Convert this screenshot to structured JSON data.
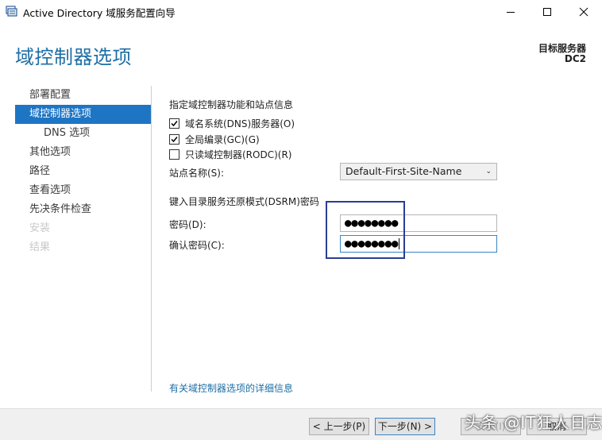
{
  "window": {
    "title": "Active Directory 域服务配置向导",
    "icon": "server-manager-icon"
  },
  "header": {
    "page_title": "域控制器选项",
    "target_label": "目标服务器",
    "target_value": "DC2"
  },
  "nav": {
    "items": [
      {
        "label": "部署配置",
        "state": "normal"
      },
      {
        "label": "域控制器选项",
        "state": "active"
      },
      {
        "label": "DNS 选项",
        "state": "sub"
      },
      {
        "label": "其他选项",
        "state": "normal"
      },
      {
        "label": "路径",
        "state": "normal"
      },
      {
        "label": "查看选项",
        "state": "normal"
      },
      {
        "label": "先决条件检查",
        "state": "normal"
      },
      {
        "label": "安装",
        "state": "disabled"
      },
      {
        "label": "结果",
        "state": "disabled"
      }
    ]
  },
  "main": {
    "capabilities_heading": "指定域控制器功能和站点信息",
    "checkboxes": [
      {
        "label": "域名系统(DNS)服务器(O)",
        "checked": true
      },
      {
        "label": "全局编录(GC)(G)",
        "checked": true
      },
      {
        "label": "只读域控制器(RODC)(R)",
        "checked": false
      }
    ],
    "site_label": "站点名称(S):",
    "site_value": "Default-First-Site-Name",
    "dsrm_heading": "键入目录服务还原模式(DSRM)密码",
    "password_label": "密码(D):",
    "password_value": "●●●●●●●●",
    "confirm_label": "确认密码(C):",
    "confirm_value": "●●●●●●●●",
    "more_link": "有关域控制器选项的详细信息"
  },
  "footer": {
    "back": "< 上一步(P)",
    "next": "下一步(N) >",
    "install": "安装(I)",
    "cancel": "取消"
  },
  "watermark": "头条 @IT狂人日志",
  "colors": {
    "accent": "#1e75c4",
    "title": "#1e6ea5",
    "highlight_box": "#2a3e93"
  }
}
